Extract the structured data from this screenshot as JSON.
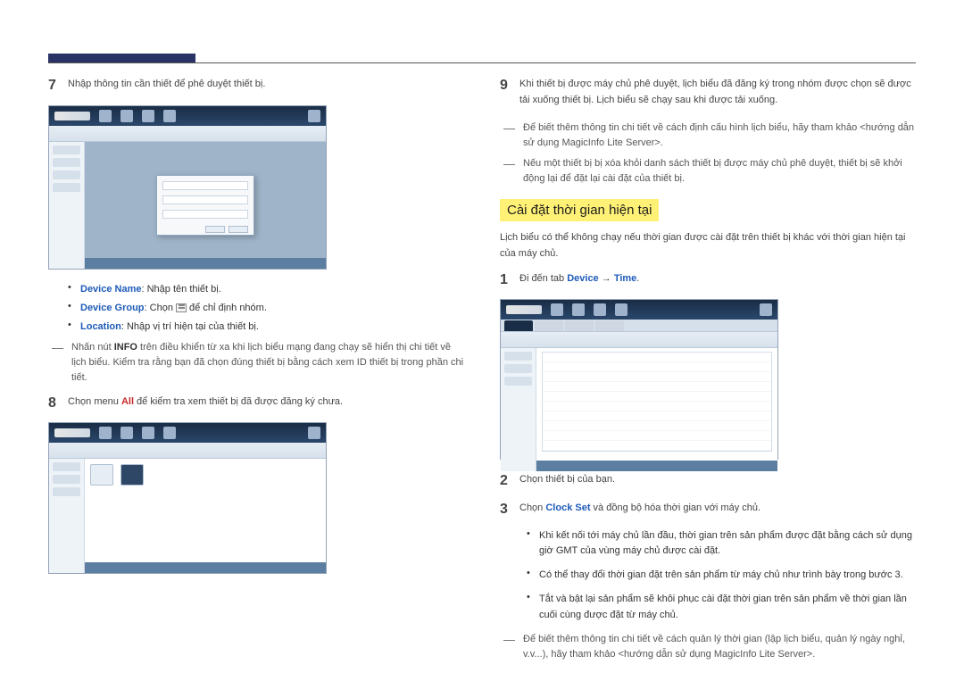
{
  "left": {
    "step7": {
      "num": "7",
      "text": "Nhập thông tin cần thiết để phê duyệt thiết bị.",
      "b_device_name_l": "Device Name",
      "b_device_name_t": ": Nhập tên thiết bị.",
      "b_device_group_l": "Device Group",
      "b_device_group_t_pre": ": Chọn ",
      "b_device_group_t_post": " để chỉ định nhóm.",
      "b_location_l": "Location",
      "b_location_t": ": Nhập vị trí hiện tại của thiết bị.",
      "dash_pre": "Nhấn nút ",
      "dash_info": "INFO",
      "dash_post": " trên điều khiển từ xa khi lịch biểu mạng đang chạy sẽ hiển thị chi tiết về lịch biểu. Kiểm tra rằng bạn đã chọn đúng thiết bị bằng cách xem ID thiết bị trong phần chi tiết."
    },
    "step8": {
      "num": "8",
      "text_pre": "Chọn menu ",
      "text_all": "All",
      "text_post": " để kiểm tra xem thiết bị đã được đăng ký chưa."
    }
  },
  "right": {
    "step9": {
      "num": "9",
      "text": "Khi thiết bị được máy chủ phê duyệt, lịch biểu đã đăng ký trong nhóm được chọn sẽ được tải xuống thiết bị. Lịch biểu sẽ chạy sau khi được tải xuống.",
      "dash1": "Để biết thêm thông tin chi tiết về cách định cấu hình lịch biểu, hãy tham khảo <hướng dẫn sử dụng MagicInfo Lite Server>.",
      "dash2": "Nếu một thiết bị bị xóa khỏi danh sách thiết bị được máy chủ phê duyệt, thiết bị sẽ khởi động lại để đặt lại cài đặt của thiết bị."
    },
    "heading": "Cài đặt thời gian hiện tại",
    "intro": "Lịch biểu có thể không chạy nếu thời gian được cài đặt trên thiết bị khác với thời gian hiện tại của máy chủ.",
    "step1": {
      "num": "1",
      "pre": "Đi đến tab ",
      "kw1": "Device",
      "arrow": " → ",
      "kw2": "Time",
      "post": "."
    },
    "step2": {
      "num": "2",
      "text": "Chọn thiết bị của bạn."
    },
    "step3": {
      "num": "3",
      "pre": "Chọn ",
      "kw": "Clock Set",
      "post": " và đồng bộ hóa thời gian với máy chủ.",
      "b1": "Khi kết nối tới máy chủ lần đầu, thời gian trên sản phẩm được đặt bằng cách sử dụng giờ GMT của vùng máy chủ được cài đặt.",
      "b2": "Có thể thay đổi thời gian đặt trên sản phẩm từ máy chủ như trình bày trong bước 3.",
      "b3": "Tắt và bật lại sản phẩm sẽ khôi phục cài đặt thời gian trên sản phẩm về thời gian lần cuối cùng được đặt từ máy chủ.",
      "dash": "Để biết thêm thông tin chi tiết về cách quản lý thời gian (lập lịch biểu, quản lý ngày nghỉ, v.v...), hãy tham khảo <hướng dẫn sử dụng MagicInfo Lite Server>."
    }
  }
}
